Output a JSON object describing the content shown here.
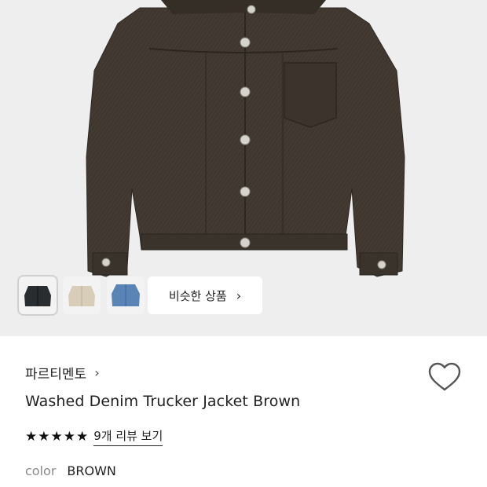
{
  "product": {
    "brand": "파르티멘토",
    "brand_chevron": "›",
    "name": "Washed Denim Trucker Jacket Brown",
    "stars": "★★★★★",
    "rating": 5,
    "review_link": "9개 리뷰 보기",
    "color_label": "color",
    "color_value": "BROWN"
  },
  "similar": {
    "label": "비슷한 상품",
    "chevron": "›"
  },
  "thumbnails": [
    {
      "name": "black-jacket",
      "color": "#2a2d30"
    },
    {
      "name": "beige-jacket",
      "color": "#d8cdb8"
    },
    {
      "name": "blue-denim-jacket",
      "color": "#5b84b6"
    }
  ],
  "icons": {
    "wishlist": "heart-outline-icon"
  },
  "colors": {
    "jacket": "#3f372f",
    "background": "#eeeeee",
    "text": "#222222",
    "muted": "#8a8a8a"
  }
}
